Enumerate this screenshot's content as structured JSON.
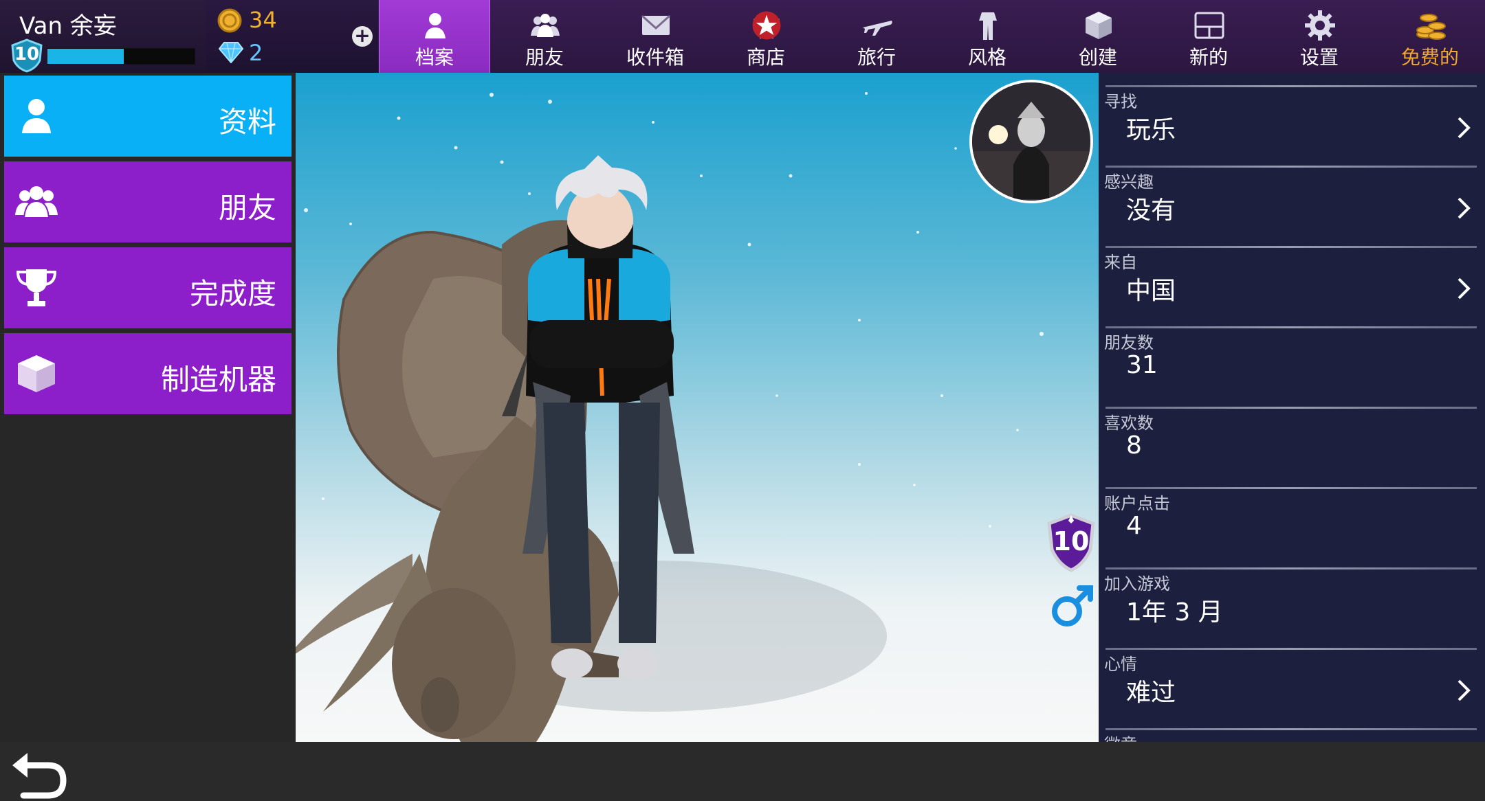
{
  "player": {
    "name": "Van 余妄",
    "level": "10",
    "xp_fraction": 0.52
  },
  "currency": {
    "coins": "34",
    "gems": "2"
  },
  "nav": {
    "tabs": [
      {
        "label": "档案",
        "icon": "profile-icon",
        "active": true
      },
      {
        "label": "朋友",
        "icon": "friends-icon"
      },
      {
        "label": "收件箱",
        "icon": "envelope-icon"
      },
      {
        "label": "商店",
        "icon": "shirt-icon"
      },
      {
        "label": "旅行",
        "icon": "airplane-icon"
      },
      {
        "label": "风格",
        "icon": "outfit-icon"
      },
      {
        "label": "创建",
        "icon": "cube-icon"
      },
      {
        "label": "新的",
        "icon": "frame-icon"
      },
      {
        "label": "设置",
        "icon": "gear-icon"
      },
      {
        "label": "免费的",
        "icon": "coin-stack-icon"
      }
    ]
  },
  "menu": {
    "items": [
      {
        "label": "资料",
        "icon": "person-icon",
        "active": true
      },
      {
        "label": "朋友",
        "icon": "friends-icon"
      },
      {
        "label": "完成度",
        "icon": "trophy-icon"
      },
      {
        "label": "制造机器",
        "icon": "cube-icon"
      }
    ]
  },
  "scene": {
    "level_badge": "10",
    "gender": "male"
  },
  "info": {
    "rows": [
      {
        "label": "寻找",
        "value": "玩乐",
        "has_arrow": true
      },
      {
        "label": "感兴趣",
        "value": "没有",
        "has_arrow": true
      },
      {
        "label": "来自",
        "value": "中国",
        "has_arrow": true
      },
      {
        "label": "朋友数",
        "value": "31",
        "has_arrow": false
      },
      {
        "label": "喜欢数",
        "value": "8",
        "has_arrow": false
      },
      {
        "label": "账户点击",
        "value": "4",
        "has_arrow": false
      },
      {
        "label": "加入游戏",
        "value": "1年 3 月",
        "has_arrow": false
      },
      {
        "label": "心情",
        "value": "难过",
        "has_arrow": true
      },
      {
        "label": "徽章",
        "value": "",
        "has_arrow": false
      }
    ]
  },
  "colors": {
    "accent_purple": "#8c1fc9",
    "accent_blue": "#0ab0f5",
    "gold": "#f0b030",
    "panel": "#1c1f3e"
  }
}
